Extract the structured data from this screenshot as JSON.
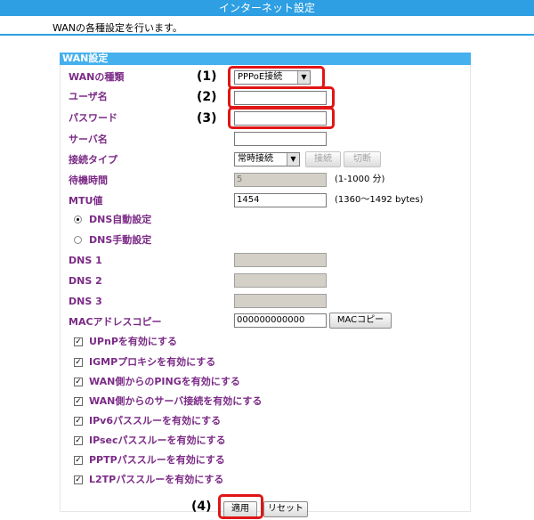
{
  "header": {
    "title": "インターネット設定"
  },
  "description": "WANの各種設定を行います。",
  "section": {
    "title": "WAN設定"
  },
  "fields": {
    "wan_type": {
      "label": "WANの種類",
      "value": "PPPoE接続"
    },
    "username": {
      "label": "ユーザ名",
      "value": ""
    },
    "password": {
      "label": "パスワード",
      "value": ""
    },
    "server_name": {
      "label": "サーバ名",
      "value": ""
    },
    "connection_type": {
      "label": "接続タイプ",
      "value": "常時接続",
      "connect_label": "接続",
      "disconnect_label": "切断"
    },
    "idle_time": {
      "label": "待機時間",
      "value": "5",
      "note": "(1-1000 分)"
    },
    "mtu": {
      "label": "MTU値",
      "value": "1454",
      "note": "(1360〜1492 bytes)"
    }
  },
  "dns": {
    "auto_label": "DNS自動設定",
    "manual_label": "DNS手動設定",
    "selected": "auto",
    "dns1_label": "DNS 1",
    "dns2_label": "DNS 2",
    "dns3_label": "DNS 3"
  },
  "mac": {
    "label": "MACアドレスコピー",
    "value": "000000000000",
    "button": "MACコピー"
  },
  "checkboxes": [
    {
      "label": "UPnPを有効にする",
      "checked": true
    },
    {
      "label": "IGMPプロキシを有効にする",
      "checked": true
    },
    {
      "label": "WAN側からのPINGを有効にする",
      "checked": true
    },
    {
      "label": "WAN側からのサーバ接続を有効にする",
      "checked": true
    },
    {
      "label": "IPv6パススルーを有効にする",
      "checked": true
    },
    {
      "label": "IPsecパススルーを有効にする",
      "checked": true
    },
    {
      "label": "PPTPパススルーを有効にする",
      "checked": true
    },
    {
      "label": "L2TPパススルーを有効にする",
      "checked": true
    }
  ],
  "buttons": {
    "apply": "適用",
    "reset": "リセット"
  },
  "callouts": [
    "(1)",
    "(2)",
    "(3)",
    "(4)"
  ],
  "colors": {
    "header": "#2e9fe3",
    "label": "#7b2b86",
    "callout": "#e11515"
  }
}
